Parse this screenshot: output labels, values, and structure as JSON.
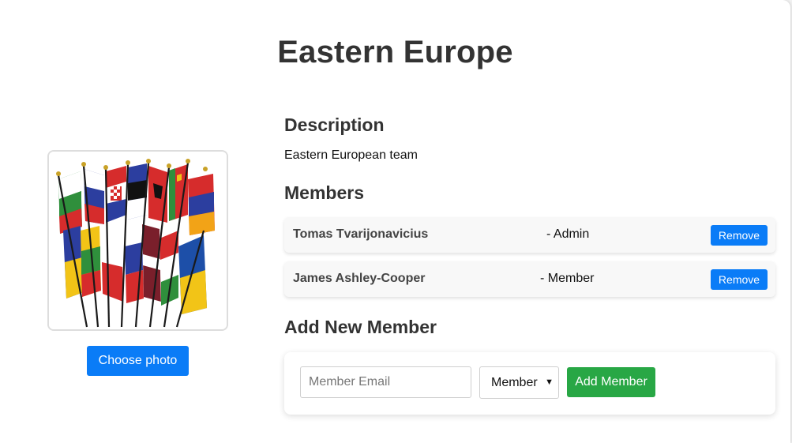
{
  "page": {
    "title": "Eastern Europe"
  },
  "photo": {
    "alt": "team-flags-image",
    "choose_label": "Choose photo",
    "flag_colors": [
      "#2f8f3c",
      "#ffffff",
      "#d62c2c",
      "#2c3e9f",
      "#f2c417",
      "#1d4fa8",
      "#7a1f2b"
    ]
  },
  "description": {
    "heading": "Description",
    "text": "Eastern European team"
  },
  "members": {
    "heading": "Members",
    "rows": [
      {
        "name": "Tomas Tvarijonavicius",
        "role": "- Admin",
        "remove_label": "Remove"
      },
      {
        "name": "James Ashley-Cooper",
        "role": "- Member",
        "remove_label": "Remove"
      }
    ]
  },
  "add_member": {
    "heading": "Add New Member",
    "email_placeholder": "Member Email",
    "email_value": "",
    "role_selected": "Member",
    "submit_label": "Add Member"
  },
  "colors": {
    "primary": "#0a7cf7",
    "success": "#28a745",
    "heading": "#333333"
  }
}
